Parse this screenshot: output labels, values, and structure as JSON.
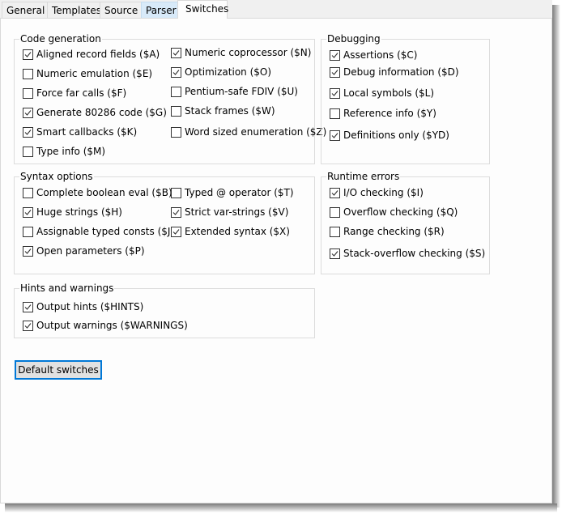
{
  "tabs": [
    {
      "label": "General",
      "state": "normal"
    },
    {
      "label": "Templates",
      "state": "normal"
    },
    {
      "label": "Source",
      "state": "normal"
    },
    {
      "label": "Parser",
      "state": "hover"
    },
    {
      "label": "Switches",
      "state": "active"
    }
  ],
  "groups": {
    "code_generation": {
      "title": "Code generation",
      "items": [
        {
          "label": "Aligned record fields ($A)",
          "checked": true
        },
        {
          "label": "Numeric emulation ($E)",
          "checked": false
        },
        {
          "label": "Force far calls ($F)",
          "checked": false
        },
        {
          "label": "Generate 80286 code ($G)",
          "checked": true
        },
        {
          "label": "Smart callbacks ($K)",
          "checked": true
        },
        {
          "label": "Type info ($M)",
          "checked": false
        },
        {
          "label": "Numeric coprocessor ($N)",
          "checked": true
        },
        {
          "label": "Optimization ($O)",
          "checked": true
        },
        {
          "label": "Pentium-safe FDIV ($U)",
          "checked": false
        },
        {
          "label": "Stack frames ($W)",
          "checked": false
        },
        {
          "label": "Word sized enumeration ($Z)",
          "checked": false
        }
      ]
    },
    "debugging": {
      "title": "Debugging",
      "items": [
        {
          "label": "Assertions ($C)",
          "checked": true
        },
        {
          "label": "Debug information ($D)",
          "checked": true
        },
        {
          "label": "Local symbols ($L)",
          "checked": true
        },
        {
          "label": "Reference info ($Y)",
          "checked": false
        },
        {
          "label": "Definitions only ($YD)",
          "checked": true
        }
      ]
    },
    "syntax_options": {
      "title": "Syntax options",
      "items": [
        {
          "label": "Complete boolean eval ($B)",
          "checked": false
        },
        {
          "label": "Huge strings ($H)",
          "checked": true
        },
        {
          "label": "Assignable typed consts ($J)",
          "checked": false
        },
        {
          "label": "Open parameters ($P)",
          "checked": true
        },
        {
          "label": "Typed @ operator ($T)",
          "checked": false
        },
        {
          "label": "Strict var-strings ($V)",
          "checked": true
        },
        {
          "label": "Extended syntax ($X)",
          "checked": true
        }
      ]
    },
    "runtime_errors": {
      "title": "Runtime errors",
      "items": [
        {
          "label": "I/O checking ($I)",
          "checked": true
        },
        {
          "label": "Overflow checking ($Q)",
          "checked": false
        },
        {
          "label": "Range checking ($R)",
          "checked": false
        },
        {
          "label": "Stack-overflow checking ($S)",
          "checked": true
        }
      ]
    },
    "hints_warnings": {
      "title": "Hints and warnings",
      "items": [
        {
          "label": "Output hints ($HINTS)",
          "checked": true
        },
        {
          "label": "Output warnings ($WARNINGS)",
          "checked": true
        }
      ]
    }
  },
  "buttons": {
    "default_switches": "Default switches"
  },
  "icons": {
    "checkmark": "check-mark"
  }
}
